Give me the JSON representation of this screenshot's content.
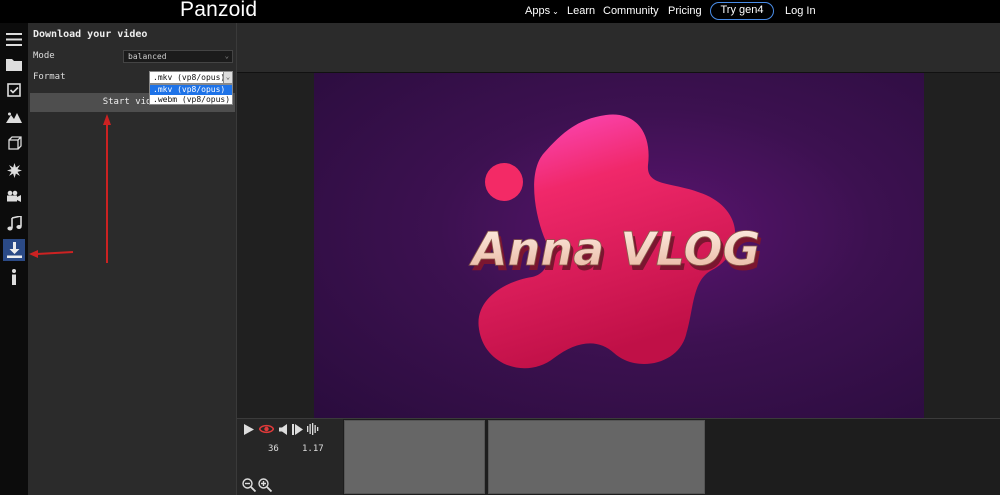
{
  "app": {
    "brand": "Panzoid",
    "nav": {
      "apps": "Apps",
      "learn": "Learn",
      "community": "Community",
      "pricing": "Pricing",
      "try_gen4": "Try gen4",
      "login": "Log In"
    }
  },
  "sidebar": {
    "items": [
      {
        "icon": "menu-icon"
      },
      {
        "icon": "folder-icon"
      },
      {
        "icon": "checkbox-icon"
      },
      {
        "icon": "image-icon"
      },
      {
        "icon": "cube-icon"
      },
      {
        "icon": "effects-icon"
      },
      {
        "icon": "camera-icon"
      },
      {
        "icon": "music-note-icon"
      },
      {
        "icon": "download-icon",
        "active": true
      },
      {
        "icon": "info-icon"
      }
    ]
  },
  "panel": {
    "title": "Download your video",
    "mode_label": "Mode",
    "mode_value": "balanced",
    "format_label": "Format",
    "format_value": ".mkv (vp8/opus)",
    "format_options": [
      ".mkv (vp8/opus)",
      ".webm (vp8/opus)"
    ],
    "start_button": "Start video"
  },
  "preview": {
    "title_text": "Anna VLOG"
  },
  "timeline": {
    "frame": "36",
    "time": "1.17"
  },
  "colors": {
    "accent": "#2b4a86",
    "gen4_border": "#4a8de8",
    "selected_option": "#1e73e8",
    "annotation": "#cc2222",
    "blob_pink": "#f0286a",
    "preview_bg": "#3c1150"
  }
}
